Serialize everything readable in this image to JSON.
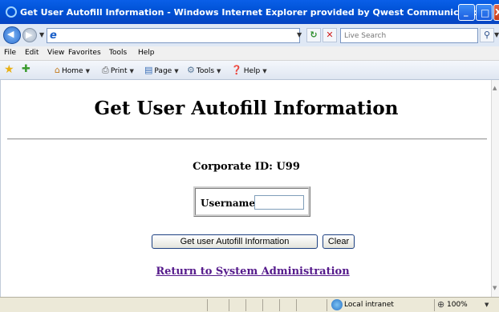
{
  "window": {
    "title": "Get User Autofill Information - Windows Internet Explorer provided by Qwest Communications",
    "minimize": "_",
    "maximize": "□",
    "close": "X"
  },
  "address_bar": {
    "url": "",
    "search_placeholder": "Live Search"
  },
  "menu": {
    "items": [
      "File",
      "Edit",
      "View",
      "Favorites",
      "Tools",
      "Help"
    ]
  },
  "command_bar": {
    "home": "Home",
    "print": "Print",
    "page": "Page",
    "tools": "Tools",
    "help": "Help"
  },
  "page": {
    "heading": "Get User Autofill Information",
    "corporate_id_label": "Corporate ID: U99",
    "username_label": "Username:",
    "username_value": "",
    "get_button": "Get user Autofill Information",
    "clear_button": "Clear",
    "return_link": "Return to System Administration"
  },
  "status_bar": {
    "status": "",
    "zone": "Local intranet",
    "zoom": "100%"
  },
  "icons": {
    "browser": "ie-logo-icon",
    "back": "back-arrow-icon",
    "forward": "forward-arrow-icon",
    "refresh": "refresh-icon",
    "stop": "stop-icon",
    "search": "search-icon",
    "favorites": "favorites-star-icon",
    "add_favorites": "add-favorites-icon",
    "home": "home-icon",
    "print": "print-icon",
    "page": "page-icon",
    "tools": "tools-gear-icon",
    "help": "help-icon",
    "zone": "intranet-globe-icon",
    "zoom": "zoom-icon"
  },
  "colors": {
    "titlebar": "#0052d6",
    "visited_link": "#551a8b",
    "button_border": "#1c3f80"
  }
}
